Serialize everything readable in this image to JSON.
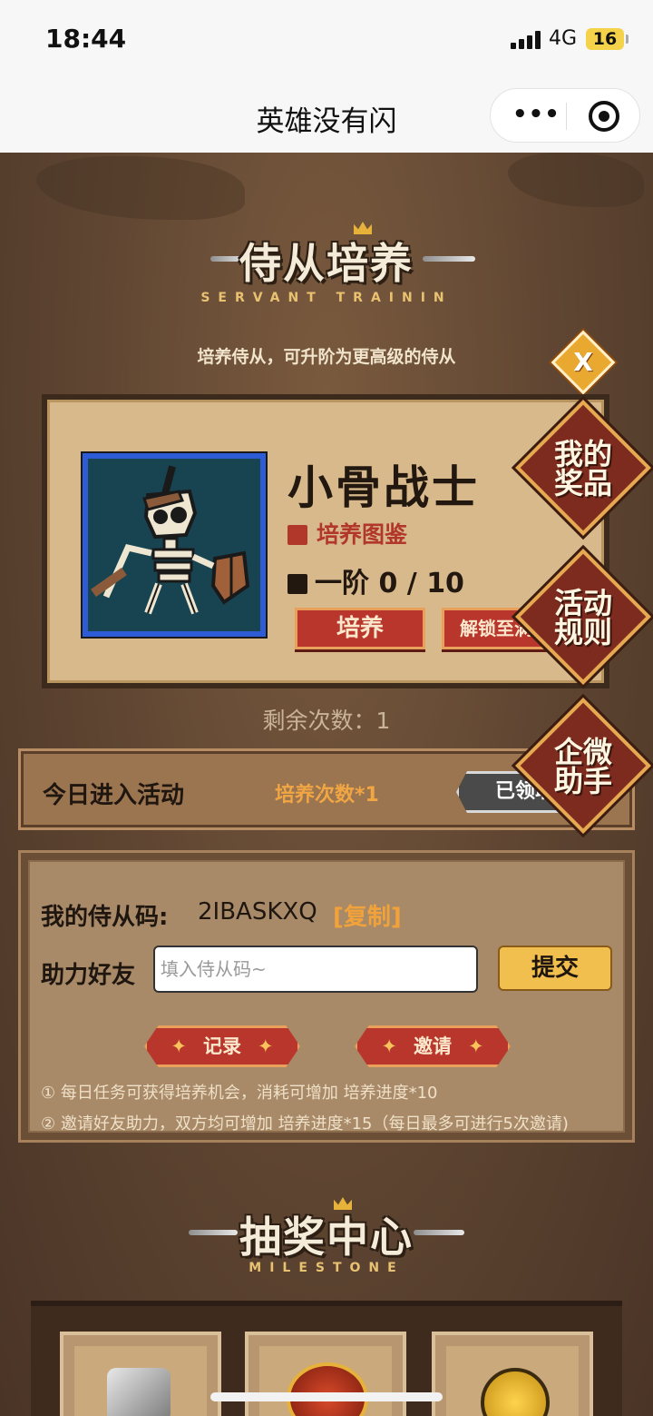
{
  "status_bar": {
    "time": "18:44",
    "network": "4G",
    "battery": "16"
  },
  "nav": {
    "title": "英雄没有闪",
    "more_icon": "more-dots-icon",
    "close_icon": "target-icon"
  },
  "servant_section": {
    "title": "侍从培养",
    "subtitle": "SERVANT TRAININ",
    "tagline": "培养侍从，可升阶为更高级的侍从",
    "close_label": "X"
  },
  "hero": {
    "name": "小骨战士",
    "codex_label": "培养图鉴",
    "rank_label": "一阶",
    "progress_current": "0",
    "progress_max": "10",
    "train_button": "培养",
    "unlock_button": "解锁至满"
  },
  "side_buttons": {
    "my_prizes": [
      "我的",
      "奖品"
    ],
    "rules": [
      "活动",
      "规则"
    ],
    "assistant": [
      "企微",
      "助手"
    ]
  },
  "remaining": {
    "label": "剩余次数：",
    "value": "1"
  },
  "daily": {
    "label": "今日进入活动",
    "reward": "培养次数*1",
    "status": "已领取"
  },
  "code_panel": {
    "my_code_label": "我的侍从码:",
    "my_code_value": "2IBASKXQ",
    "copy_label": "[复制]",
    "help_label": "助力好友",
    "input_placeholder": "填入侍从码~",
    "submit_label": "提交",
    "record_label": "记录",
    "invite_label": "邀请",
    "rules": [
      "① 每日任务可获得培养机会，消耗可增加 培养进度*10",
      "② 邀请好友助力，双方均可增加 培养进度*15（每日最多可进行5次邀请)"
    ]
  },
  "lottery_section": {
    "title": "抽奖中心",
    "subtitle": "MILESTONE"
  }
}
